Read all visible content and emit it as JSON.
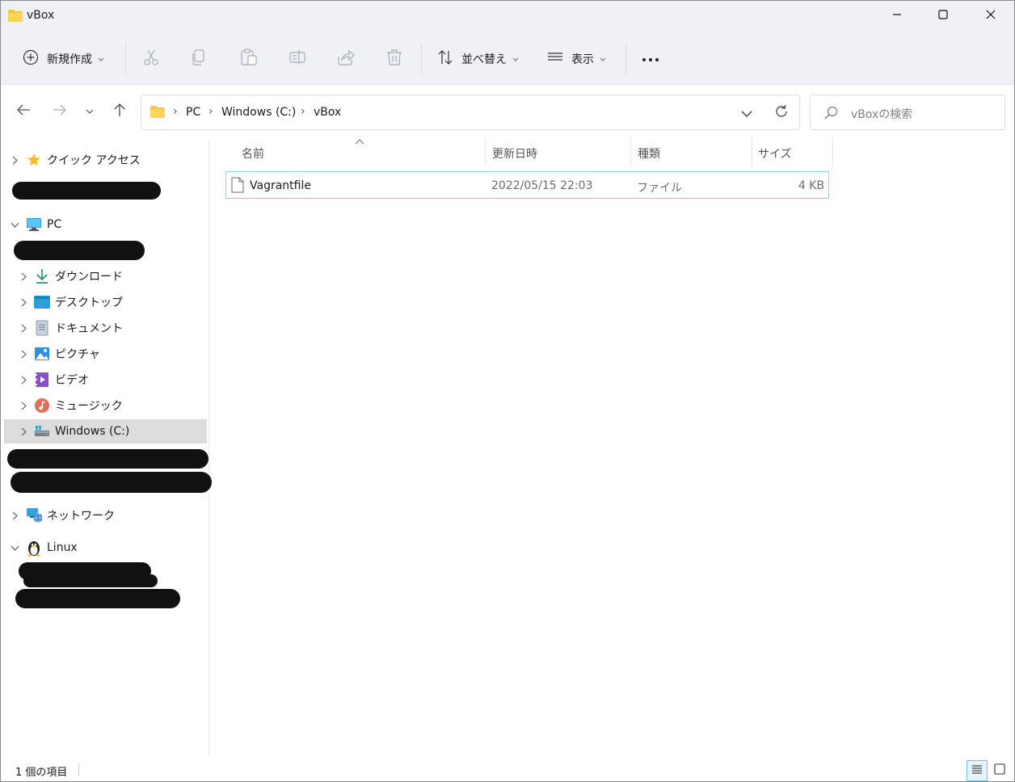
{
  "window": {
    "title": "vBox"
  },
  "toolbar": {
    "new_label": "新規作成",
    "sort_label": "並べ替え",
    "view_label": "表示"
  },
  "address": {
    "crumbs": [
      "PC",
      "Windows (C:)",
      "vBox"
    ]
  },
  "search": {
    "placeholder": "vBoxの検索"
  },
  "sidebar": {
    "quick_access": "クイック アクセス",
    "pc": "PC",
    "items": [
      {
        "label": "ダウンロード",
        "icon": "download-icon"
      },
      {
        "label": "デスクトップ",
        "icon": "desktop-icon"
      },
      {
        "label": "ドキュメント",
        "icon": "documents-icon"
      },
      {
        "label": "ピクチャ",
        "icon": "pictures-icon"
      },
      {
        "label": "ビデオ",
        "icon": "videos-icon"
      },
      {
        "label": "ミュージック",
        "icon": "music-icon"
      },
      {
        "label": "Windows (C:)",
        "icon": "drive-icon"
      }
    ],
    "network": "ネットワーク",
    "linux": "Linux"
  },
  "columns": {
    "name": "名前",
    "date": "更新日時",
    "type": "種類",
    "size": "サイズ"
  },
  "files": [
    {
      "name": "Vagrantfile",
      "date": "2022/05/15 22:03",
      "type": "ファイル",
      "size": "4 KB"
    }
  ],
  "status": {
    "count": "1 個の項目"
  },
  "colors": {
    "chrome": "#eef1f6",
    "selection_border": "#99d1e3",
    "folder": "#f6c443"
  }
}
